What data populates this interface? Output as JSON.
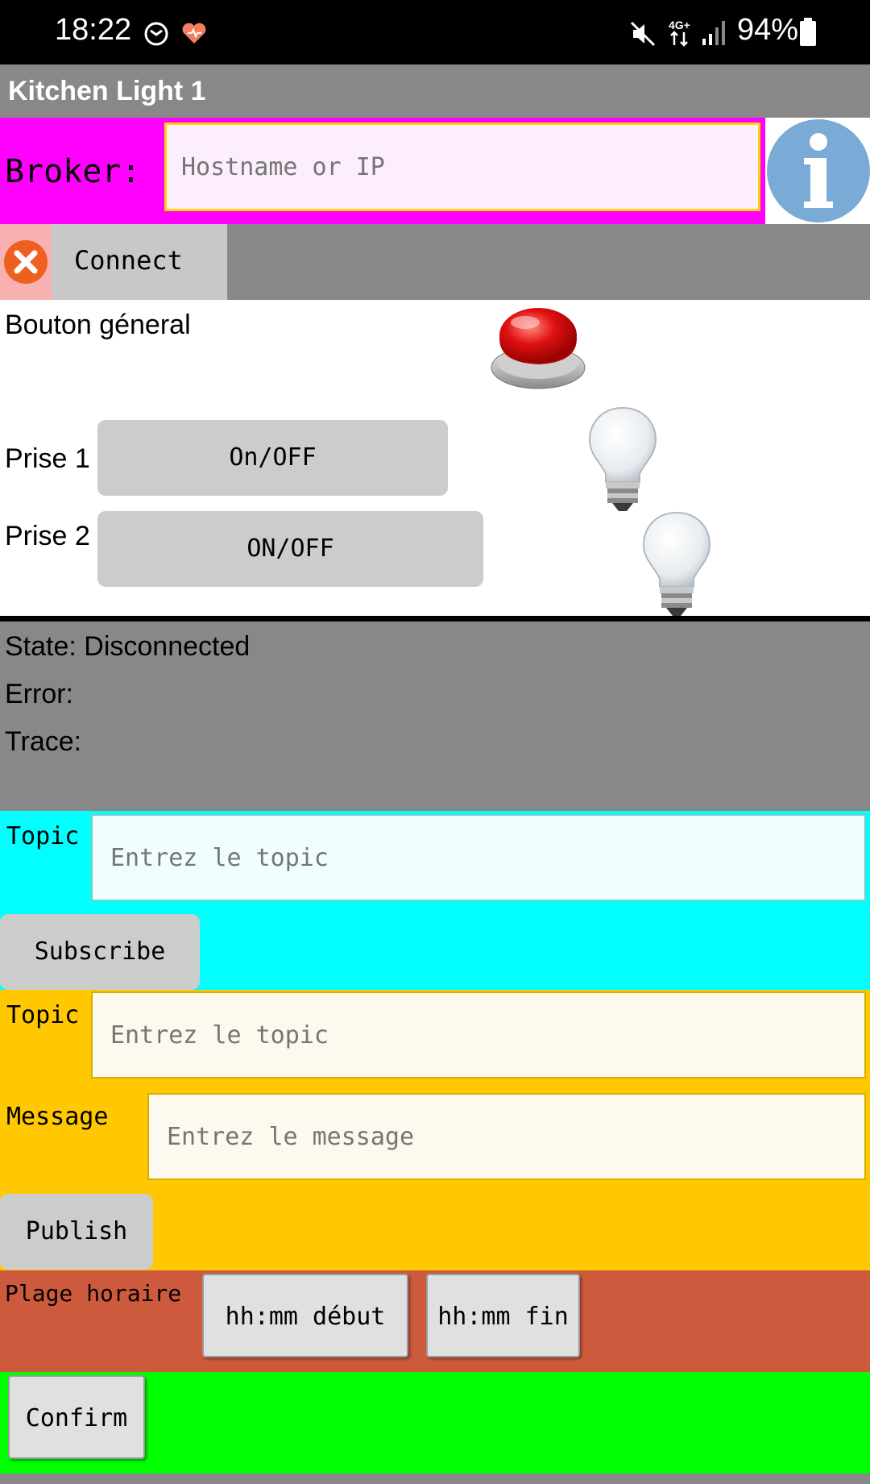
{
  "status_bar": {
    "time": "18:22",
    "battery": "94%"
  },
  "app": {
    "title": "Kitchen Light 1"
  },
  "broker": {
    "label": "Broker:",
    "placeholder": "Hostname or IP"
  },
  "connect": {
    "label": "Connect"
  },
  "controls": {
    "general_label": "Bouton géneral",
    "prise1_label": "Prise 1",
    "prise1_button": "On/OFF",
    "prise2_label": "Prise 2",
    "prise2_button": "ON/OFF"
  },
  "state": {
    "state_text": "State: Disconnected",
    "error_text": "Error:",
    "trace_text": "Trace:"
  },
  "subscribe": {
    "topic_label": "Topic",
    "topic_placeholder": "Entrez le topic",
    "button": "Subscribe"
  },
  "publish": {
    "topic_label": "Topic",
    "topic_placeholder": "Entrez le topic",
    "message_label": "Message",
    "message_placeholder": "Entrez le message",
    "button": "Publish"
  },
  "schedule": {
    "label": "Plage horaire",
    "start_button": "hh:mm début",
    "end_button": "hh:mm fin"
  },
  "confirm": {
    "button": "Confirm"
  },
  "colors": {
    "broker_bg": "#ff00ff",
    "subscribe_bg": "#00ffff",
    "publish_bg": "#ffc800",
    "schedule_bg": "#cd5a3c",
    "confirm_bg": "#00ff00",
    "panel_gray": "#888888"
  }
}
